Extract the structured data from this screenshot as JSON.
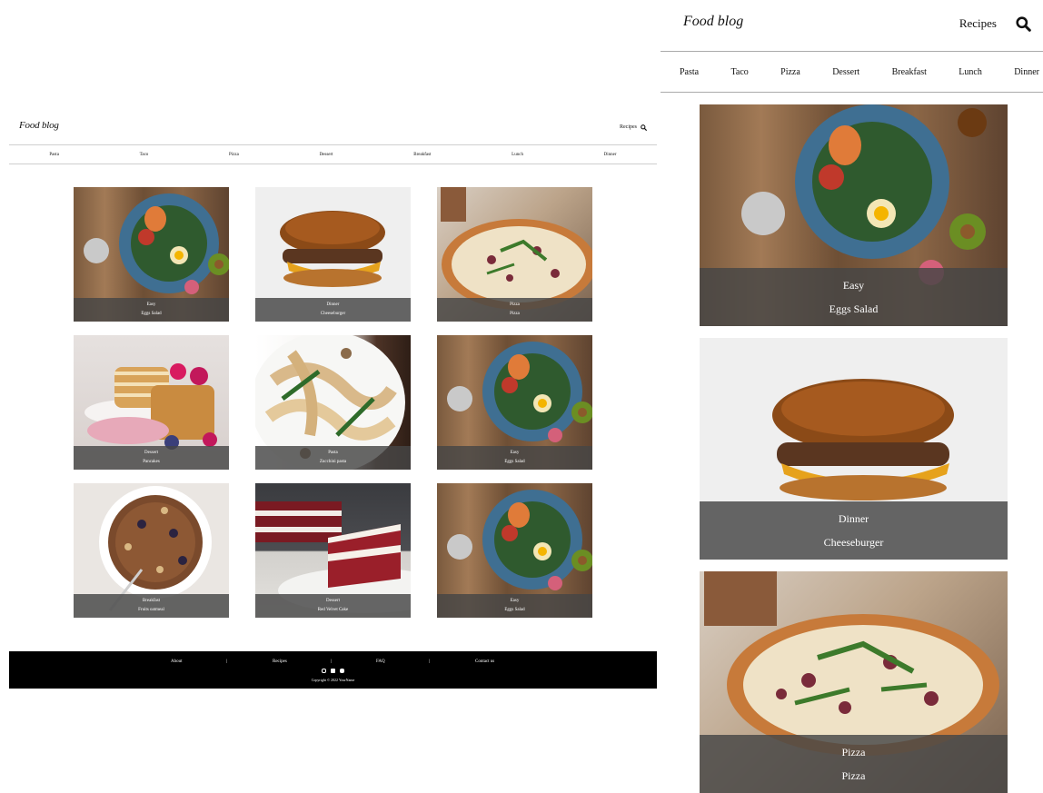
{
  "brand": {
    "logo": "Food blog",
    "nav_link": "Recipes"
  },
  "categories": [
    "Pasta",
    "Taco",
    "Pizza",
    "Dessert",
    "Breakfast",
    "Lunch",
    "Dinner"
  ],
  "recipes": [
    {
      "category": "Easy",
      "name": "Eggs Salad",
      "photo": "salad"
    },
    {
      "category": "Dinner",
      "name": "Cheeseburger",
      "photo": "burger"
    },
    {
      "category": "Pizza",
      "name": "Pizza",
      "photo": "pizza"
    },
    {
      "category": "Dessert",
      "name": "Pancakes",
      "photo": "pancakes"
    },
    {
      "category": "Pasta",
      "name": "Zucchini pasta",
      "photo": "pasta"
    },
    {
      "category": "Easy",
      "name": "Eggs Salad",
      "photo": "salad"
    },
    {
      "category": "Breakfast",
      "name": "Fruits oatmeal",
      "photo": "oatmeal"
    },
    {
      "category": "Dessert",
      "name": "Red Velvet Cake",
      "photo": "cake"
    },
    {
      "category": "Easy",
      "name": "Eggs Salad",
      "photo": "salad"
    }
  ],
  "footer": {
    "links": [
      "About",
      "|",
      "Recipes",
      "|",
      "FAQ",
      "|",
      "Contact us"
    ],
    "social_icons": [
      "instagram-icon",
      "facebook-icon",
      "youtube-icon"
    ],
    "copyright": "Copyright © 2022 YourName"
  },
  "icons": {
    "search": "search-icon"
  },
  "colors": {
    "caption_overlay": "#464646",
    "footer_bg": "#000000",
    "divider": "#cfcfcf"
  }
}
